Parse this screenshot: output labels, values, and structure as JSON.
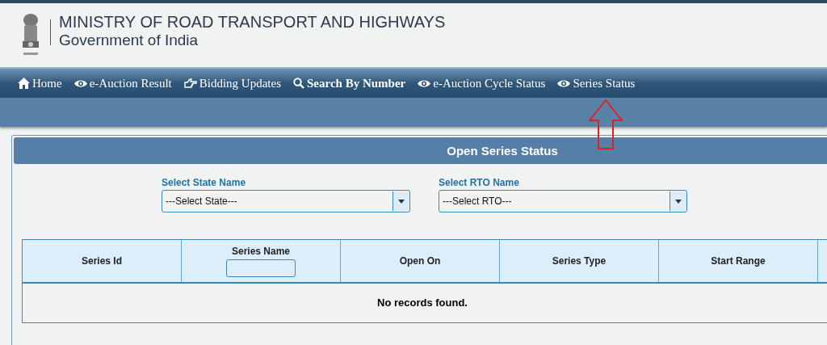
{
  "header": {
    "title": "MINISTRY OF ROAD TRANSPORT AND HIGHWAYS",
    "subtitle": "Government of India"
  },
  "nav": [
    {
      "label": "Home",
      "kind": "home",
      "bold": false
    },
    {
      "label": "e-Auction Result",
      "kind": "eye",
      "bold": false
    },
    {
      "label": "Bidding Updates",
      "kind": "hand",
      "bold": false
    },
    {
      "label": "Search By Number",
      "kind": "search",
      "bold": true
    },
    {
      "label": "e-Auction Cycle Status",
      "kind": "eye",
      "bold": false
    },
    {
      "label": "Series Status",
      "kind": "eye",
      "bold": false
    }
  ],
  "panel": {
    "title": "Open Series Status"
  },
  "filters": [
    {
      "label": "Select State Name",
      "value": "---Select State---"
    },
    {
      "label": "Select RTO Name",
      "value": "---Select RTO---"
    }
  ],
  "table": {
    "columns": [
      {
        "label": "Series Id",
        "filter": false
      },
      {
        "label": "Series Name",
        "filter": true
      },
      {
        "label": "Open On",
        "filter": false
      },
      {
        "label": "Series Type",
        "filter": false
      },
      {
        "label": "Start Range",
        "filter": false
      }
    ],
    "empty_message": "No records found."
  }
}
